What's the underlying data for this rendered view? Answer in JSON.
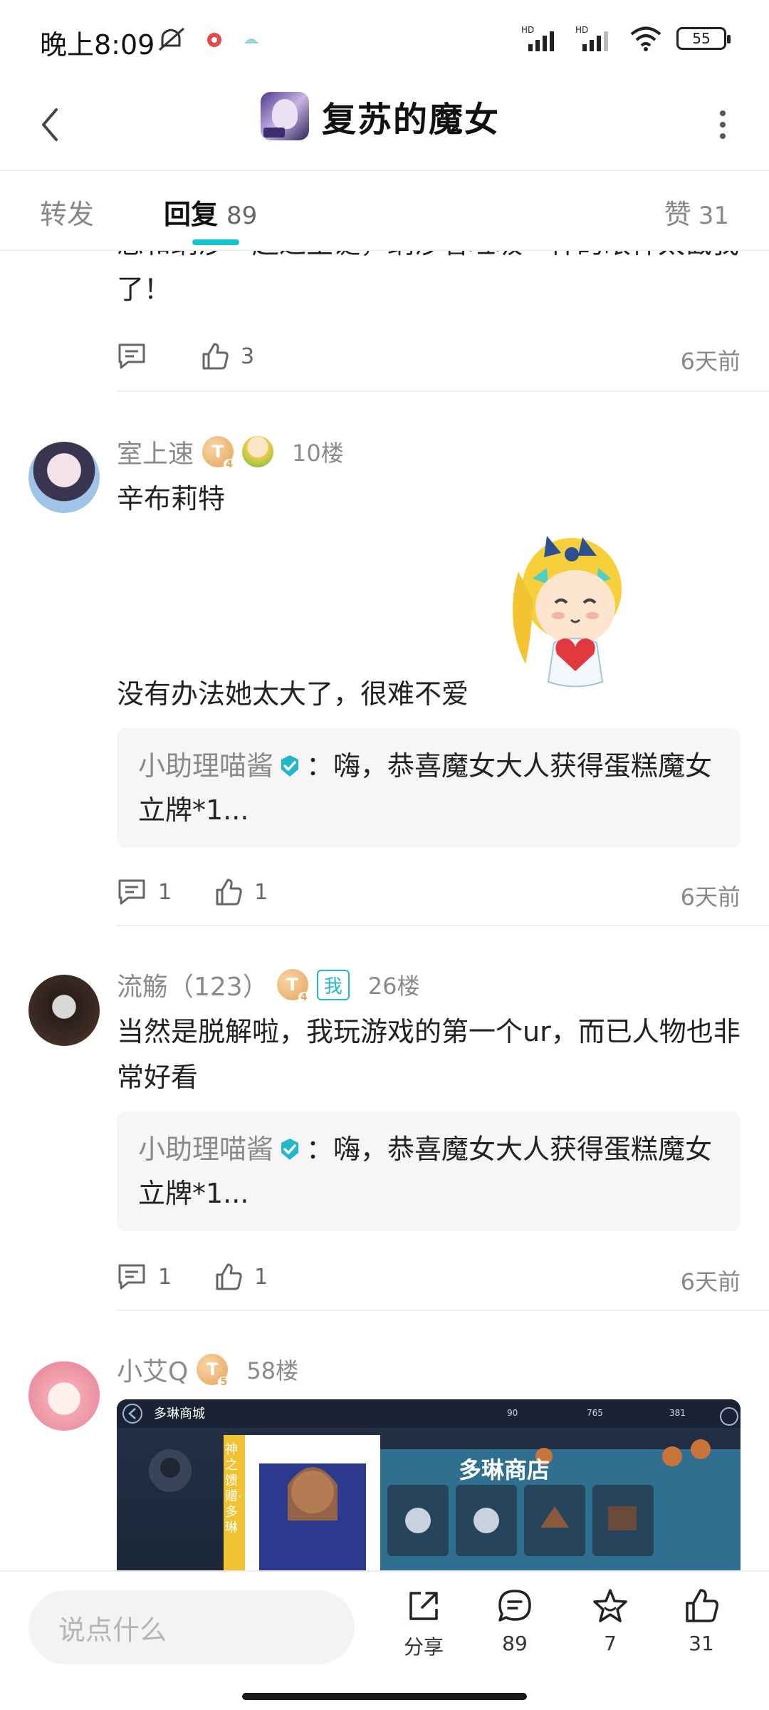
{
  "status_bar": {
    "time": "晚上8:09",
    "battery": "55",
    "icons": [
      "mute-icon",
      "app-notification-icon",
      "app-notification-icon-2",
      "hd-signal-icon",
      "hd-signal-icon-2",
      "wifi-icon",
      "battery-icon"
    ]
  },
  "header": {
    "title": "复苏的魔女",
    "back_icon": "chevron-left-icon",
    "more_icon": "more-vertical-icon"
  },
  "tabs": {
    "forward": "转发",
    "reply": "回复",
    "reply_count": "89",
    "like": "赞",
    "like_count": "31"
  },
  "comments": [
    {
      "partial_text": "您和纳沙一起过圣诞，纳沙看垃圾一样的眼神太戳我了！",
      "reply_count": "",
      "like_count": "3",
      "time": "6天前"
    },
    {
      "username": "室上速",
      "level": "T",
      "level_sub": "4",
      "floor": "10楼",
      "text_line1": "辛布莉特",
      "text_line2": "没有办法她太大了，很难不爱",
      "reply_preview": {
        "name": "小助理喵酱",
        "text": "：嗨，恭喜魔女大人获得蛋糕魔女立牌*1..."
      },
      "reply_count": "1",
      "like_count": "1",
      "time": "6天前"
    },
    {
      "username": "流觞（123）",
      "level": "T",
      "level_sub": "4",
      "me_tag": "我",
      "floor": "26楼",
      "text": "当然是脱解啦，我玩游戏的第一个ur，而已人物也非常好看",
      "reply_preview": {
        "name": "小助理喵酱",
        "text": "：嗨，恭喜魔女大人获得蛋糕魔女立牌*1..."
      },
      "reply_count": "1",
      "like_count": "1",
      "time": "6天前"
    },
    {
      "username": "小艾Q",
      "level": "T",
      "level_sub": "5",
      "floor": "58楼",
      "image": {
        "shop_title": "多琳商城",
        "banner_left": "神之馈赠·多琳",
        "banner_right": "多琳商店",
        "currency_1": "90",
        "currency_2": "765",
        "currency_3": "381"
      }
    }
  ],
  "bottom_bar": {
    "input_placeholder": "说点什么",
    "share_label": "分享",
    "comment_count": "89",
    "favorite_count": "7",
    "like_count": "31"
  },
  "colors": {
    "accent": "#15c5ce",
    "text_secondary": "#8a8a8a",
    "verified": "#22b7c9"
  }
}
